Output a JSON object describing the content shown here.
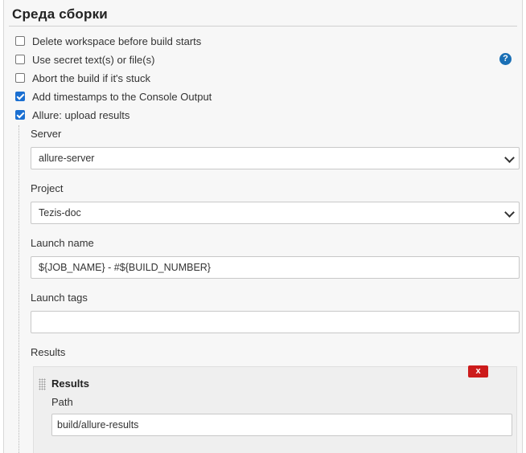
{
  "section": {
    "title": "Среда сборки"
  },
  "options": [
    {
      "label": "Delete workspace before build starts",
      "checked": false
    },
    {
      "label": "Use secret text(s) or file(s)",
      "checked": false
    },
    {
      "label": "Abort the build if it's stuck",
      "checked": false
    },
    {
      "label": "Add timestamps to the Console Output",
      "checked": true
    },
    {
      "label": "Allure: upload results",
      "checked": true
    }
  ],
  "help": {
    "icon": "help-icon",
    "glyph": "?"
  },
  "allure": {
    "server": {
      "label": "Server",
      "value": "allure-server"
    },
    "project": {
      "label": "Project",
      "value": "Tezis-doc"
    },
    "launch_name": {
      "label": "Launch name",
      "value": "${JOB_NAME} - #${BUILD_NUMBER}"
    },
    "launch_tags": {
      "label": "Launch tags",
      "value": ""
    },
    "results": {
      "label": "Results",
      "item": {
        "title": "Results",
        "delete_label": "x",
        "path_label": "Path",
        "path_value": "build/allure-results"
      }
    }
  },
  "colors": {
    "checkbox_checked": "#1a6fd1",
    "delete_button": "#cc1b1b",
    "help_icon": "#1a6fb5"
  }
}
